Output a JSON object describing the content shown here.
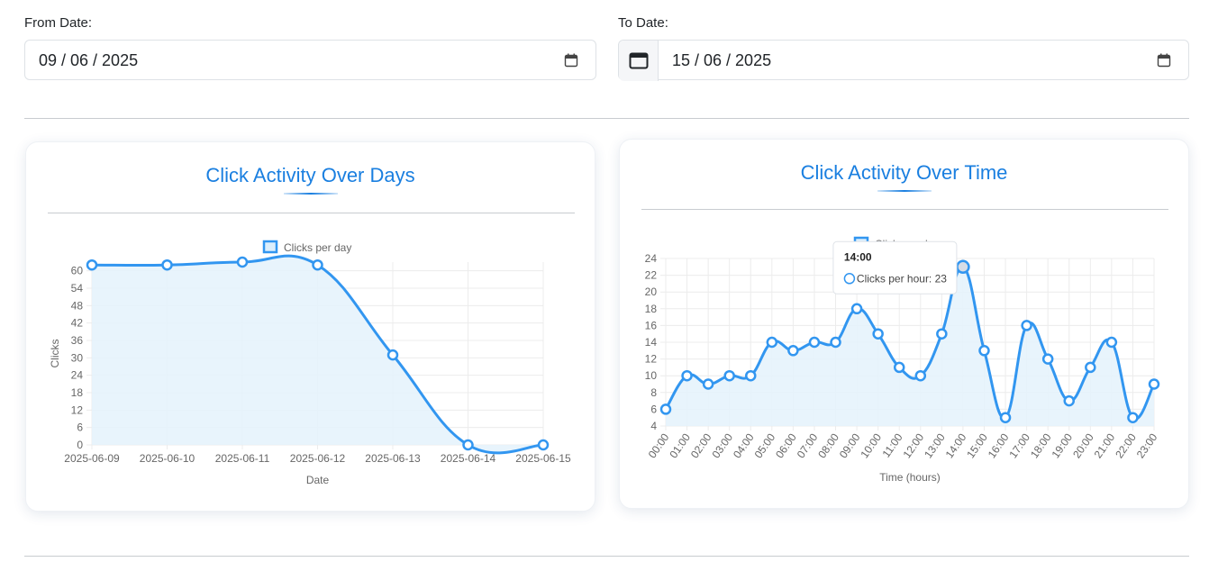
{
  "filters": {
    "from": {
      "label": "From Date:",
      "value": "09 / 06 / 2025"
    },
    "to": {
      "label": "To Date:",
      "value": "15 / 06 / 2025"
    }
  },
  "icons": {
    "calendar": "calendar-icon"
  },
  "colors": {
    "accent": "#1a7fe0",
    "line": "#3296f0",
    "fill": "#e6f3fc"
  },
  "cards": {
    "days": {
      "title": "Click Activity Over Days"
    },
    "time": {
      "title": "Click Activity Over Time"
    }
  },
  "chart_data": [
    {
      "type": "line",
      "title": "Click Activity Over Days",
      "legend": {
        "label": "Clicks per day",
        "position": "top"
      },
      "xlabel": "Date",
      "ylabel": "Clicks",
      "ylim": [
        0,
        63
      ],
      "yticks": [
        0,
        6,
        12,
        18,
        24,
        30,
        36,
        42,
        48,
        54,
        60
      ],
      "x": [
        "2025-06-09",
        "2025-06-10",
        "2025-06-11",
        "2025-06-12",
        "2025-06-13",
        "2025-06-14",
        "2025-06-15"
      ],
      "values": [
        62,
        62,
        63,
        62,
        31,
        0,
        0
      ],
      "grid": true,
      "fill": true
    },
    {
      "type": "line",
      "title": "Click Activity Over Time",
      "legend": {
        "label": "Clicks per hour",
        "position": "top"
      },
      "xlabel": "Time (hours)",
      "ylabel": "",
      "ylim": [
        4,
        24
      ],
      "yticks": [
        4,
        6,
        8,
        10,
        12,
        14,
        16,
        18,
        20,
        22,
        24
      ],
      "x": [
        "00:00",
        "01:00",
        "02:00",
        "03:00",
        "04:00",
        "05:00",
        "06:00",
        "07:00",
        "08:00",
        "09:00",
        "10:00",
        "11:00",
        "12:00",
        "13:00",
        "14:00",
        "15:00",
        "16:00",
        "17:00",
        "18:00",
        "19:00",
        "20:00",
        "21:00",
        "22:00",
        "23:00"
      ],
      "values": [
        6,
        10,
        9,
        10,
        10,
        14,
        13,
        14,
        14,
        18,
        15,
        11,
        10,
        15,
        23,
        13,
        5,
        16,
        12,
        7,
        11,
        14,
        5,
        9
      ],
      "grid": true,
      "fill": true,
      "tooltip": {
        "title": "14:00",
        "label": "Clicks per hour: 23",
        "index": 14
      }
    }
  ]
}
